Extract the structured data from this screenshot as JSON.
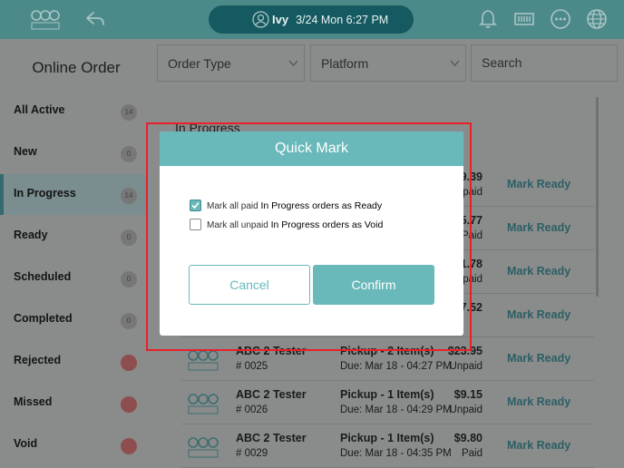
{
  "header": {
    "user_name": "Ivy",
    "datetime": "3/24 Mon 6:27 PM",
    "icons": [
      "logo-icon",
      "back-icon",
      "user-icon",
      "bell-icon",
      "printer-icon",
      "more-icon",
      "globe-icon"
    ]
  },
  "sidebar": {
    "title": "Online Order",
    "items": [
      {
        "label": "All Active",
        "count": "14"
      },
      {
        "label": "New",
        "count": "0"
      },
      {
        "label": "In Progress",
        "count": "14"
      },
      {
        "label": "Ready",
        "count": "0"
      },
      {
        "label": "Scheduled",
        "count": "0"
      },
      {
        "label": "Completed",
        "count": "0"
      },
      {
        "label": "Rejected",
        "count": ""
      },
      {
        "label": "Missed",
        "count": ""
      },
      {
        "label": "Void",
        "count": ""
      }
    ]
  },
  "filters": {
    "order_type": "Order Type",
    "platform": "Platform",
    "search_placeholder": "Search"
  },
  "main": {
    "section_title": "In Progress",
    "partial_rows": [
      {
        "price": "9.39",
        "paid": "npaid",
        "action": "Mark Ready"
      },
      {
        "price": "5.77",
        "paid": "Paid",
        "action": "Mark Ready"
      },
      {
        "price": "1.78",
        "paid": "paid",
        "action": "Mark Ready"
      },
      {
        "price": "7.52",
        "paid": "",
        "action": "Mark Ready"
      }
    ],
    "orders": [
      {
        "name": "ABC 2 Tester",
        "number": "# 0025",
        "type": "Pickup - 2 Item(s)",
        "due": "Due: Mar 18 - 04:27 PM",
        "price": "$23.95",
        "paid": "Unpaid",
        "action": "Mark Ready"
      },
      {
        "name": "ABC 2 Tester",
        "number": "# 0026",
        "type": "Pickup - 1 Item(s)",
        "due": "Due: Mar 18 - 04:29 PM",
        "price": "$9.15",
        "paid": "Unpaid",
        "action": "Mark Ready"
      },
      {
        "name": "ABC 2 Tester",
        "number": "# 0029",
        "type": "Pickup - 1 Item(s)",
        "due": "Due: Mar 18 - 04:35 PM",
        "price": "$9.80",
        "paid": "Paid",
        "action": "Mark Ready"
      }
    ]
  },
  "modal": {
    "title": "Quick Mark",
    "option1_prefix": "Mark all paid",
    "option1_suffix": "In Progress orders as Ready",
    "option1_checked": true,
    "option2_prefix": "Mark all unpaid",
    "option2_suffix": "In Progress orders as Void",
    "option2_checked": false,
    "cancel_label": "Cancel",
    "confirm_label": "Confirm"
  },
  "colors": {
    "accent": "#69b8ba",
    "header_bg": "#4c8a8a",
    "pill_bg": "#155a60",
    "overlay_bg": "#8a8c8c",
    "highlight": "#e8202a"
  }
}
